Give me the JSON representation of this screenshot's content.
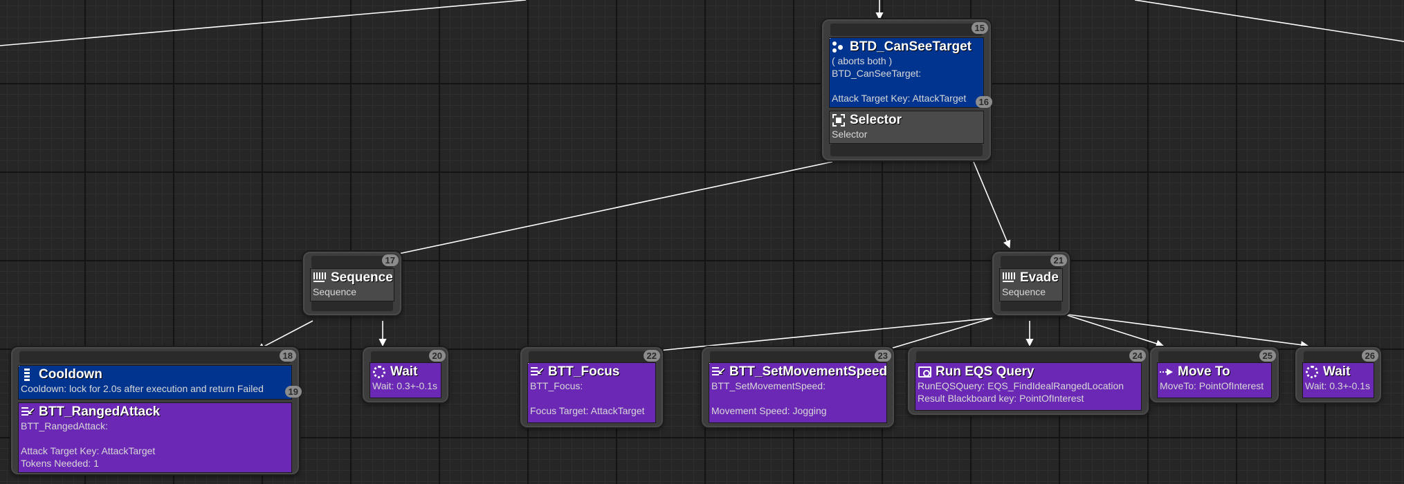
{
  "nodes": {
    "root": {
      "index": "15",
      "decorator": {
        "title": "BTD_CanSeeTarget",
        "line1": "( aborts both )",
        "line2": "BTD_CanSeeTarget:",
        "line3": "Attack Target Key: AttackTarget",
        "index": "16"
      },
      "composite": {
        "title": "Selector",
        "subtitle": "Selector"
      }
    },
    "sequence": {
      "index": "17",
      "title": "Sequence",
      "subtitle": "Sequence"
    },
    "evade": {
      "index": "21",
      "title": "Evade",
      "subtitle": "Sequence"
    },
    "ranged": {
      "index": "18",
      "decorator": {
        "title": "Cooldown",
        "line1": "Cooldown: lock for 2.0s after execution and return Failed",
        "index": "19"
      },
      "task": {
        "title": "BTT_RangedAttack",
        "line1": "BTT_RangedAttack:",
        "line2": "Attack Target Key: AttackTarget",
        "line3": "Tokens Needed: 1"
      }
    },
    "wait1": {
      "index": "20",
      "title": "Wait",
      "line1": "Wait: 0.3+-0.1s"
    },
    "focus": {
      "index": "22",
      "title": "BTT_Focus",
      "line1": "BTT_Focus:",
      "line2": "Focus Target: AttackTarget"
    },
    "movespeed": {
      "index": "23",
      "title": "BTT_SetMovementSpeed",
      "line1": "BTT_SetMovementSpeed:",
      "line2": "Movement Speed: Jogging"
    },
    "eqs": {
      "index": "24",
      "title": "Run EQS Query",
      "line1": "RunEQSQuery: EQS_FindIdealRangedLocation",
      "line2": "Result Blackboard key: PointOfInterest"
    },
    "moveto": {
      "index": "25",
      "title": "Move To",
      "line1": "MoveTo: PointOfInterest"
    },
    "wait2": {
      "index": "26",
      "title": "Wait",
      "line1": "Wait: 0.3+-0.1s"
    }
  },
  "colors": {
    "decorator": "#00348f",
    "task": "#6a28b4",
    "composite": "#4a4a4a",
    "wire": "#ffffff"
  },
  "icons": {
    "root": "decorator-icon",
    "selector": "selector-icon",
    "sequence": "sequence-icon",
    "cooldown": "cooldown-icon",
    "task": "task-icon",
    "wait": "wait-icon",
    "eqs": "eqs-query-icon",
    "moveto": "move-to-icon"
  }
}
